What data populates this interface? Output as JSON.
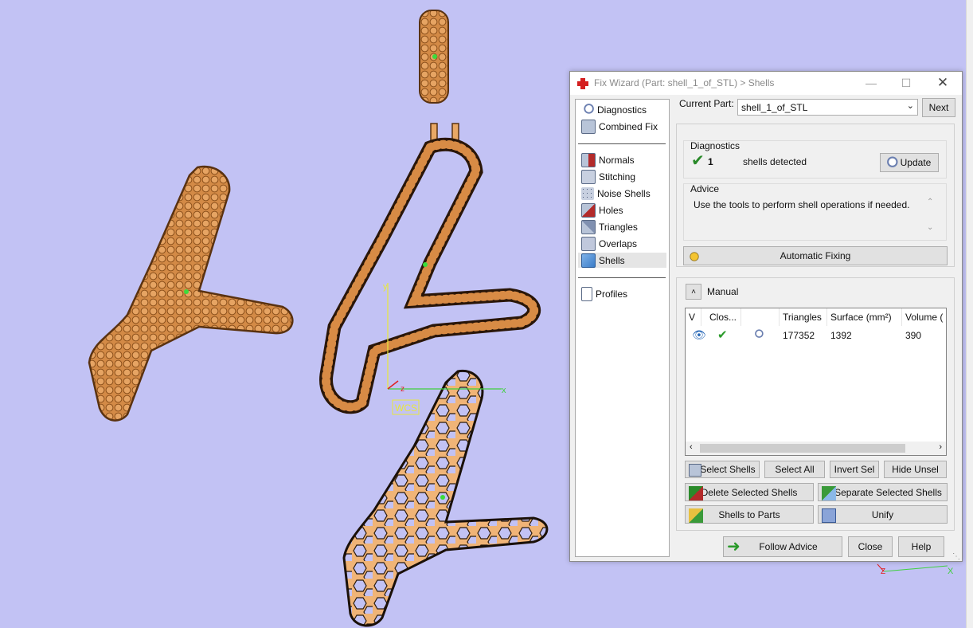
{
  "dialog": {
    "title": "Fix Wizard (Part: shell_1_of_STL) > Shells",
    "window_controls": [
      "minimize",
      "maximize",
      "close"
    ]
  },
  "nav": {
    "top_items": [
      {
        "label": "Diagnostics",
        "icon": "magnifier-icon"
      },
      {
        "label": "Combined Fix",
        "icon": "cube-icon"
      }
    ],
    "tool_items": [
      {
        "label": "Normals",
        "icon": "normals-cube-icon"
      },
      {
        "label": "Stitching",
        "icon": "stitching-cube-icon"
      },
      {
        "label": "Noise Shells",
        "icon": "noise-shells-icon"
      },
      {
        "label": "Holes",
        "icon": "holes-cube-icon"
      },
      {
        "label": "Triangles",
        "icon": "triangles-cube-icon"
      },
      {
        "label": "Overlaps",
        "icon": "overlaps-cube-icon"
      },
      {
        "label": "Shells",
        "icon": "shells-cube-icon",
        "selected": true
      }
    ],
    "bottom_items": [
      {
        "label": "Profiles",
        "icon": "document-icon"
      }
    ]
  },
  "header": {
    "current_part_label": "Current Part:",
    "current_part_value": "shell_1_of_STL",
    "next_label": "Next"
  },
  "diagnostics": {
    "heading": "Diagnostics",
    "count": "1",
    "status_text": "shells detected",
    "update_label": "Update"
  },
  "advice": {
    "heading": "Advice",
    "text": "Use the tools to perform shell operations if needed."
  },
  "automatic_fixing_label": "Automatic Fixing",
  "manual": {
    "heading": "Manual",
    "columns": [
      "V",
      "Clos...",
      "",
      "Triangles",
      "Surface (mm²)",
      "Volume ("
    ],
    "rows": [
      {
        "triangles": "177352",
        "surface": "1392",
        "volume": "390"
      }
    ]
  },
  "buttons": {
    "select_shells": "Select Shells",
    "select_all": "Select All",
    "invert_sel": "Invert Sel",
    "hide_unsel": "Hide Unsel",
    "delete_selected": "Delete Selected Shells",
    "separate_selected": "Separate Selected Shells",
    "shells_to_parts": "Shells to Parts",
    "unify": "Unify",
    "follow_advice": "Follow Advice",
    "close": "Close",
    "help": "Help"
  },
  "viewport": {
    "wcs_label": "WCS",
    "axis_y": "y",
    "axis_z": "z",
    "axis_x": "x",
    "corner_axis_z": "Z",
    "corner_axis_x": "X",
    "background": "#c2c2f4",
    "part_color": "#e9a865"
  }
}
